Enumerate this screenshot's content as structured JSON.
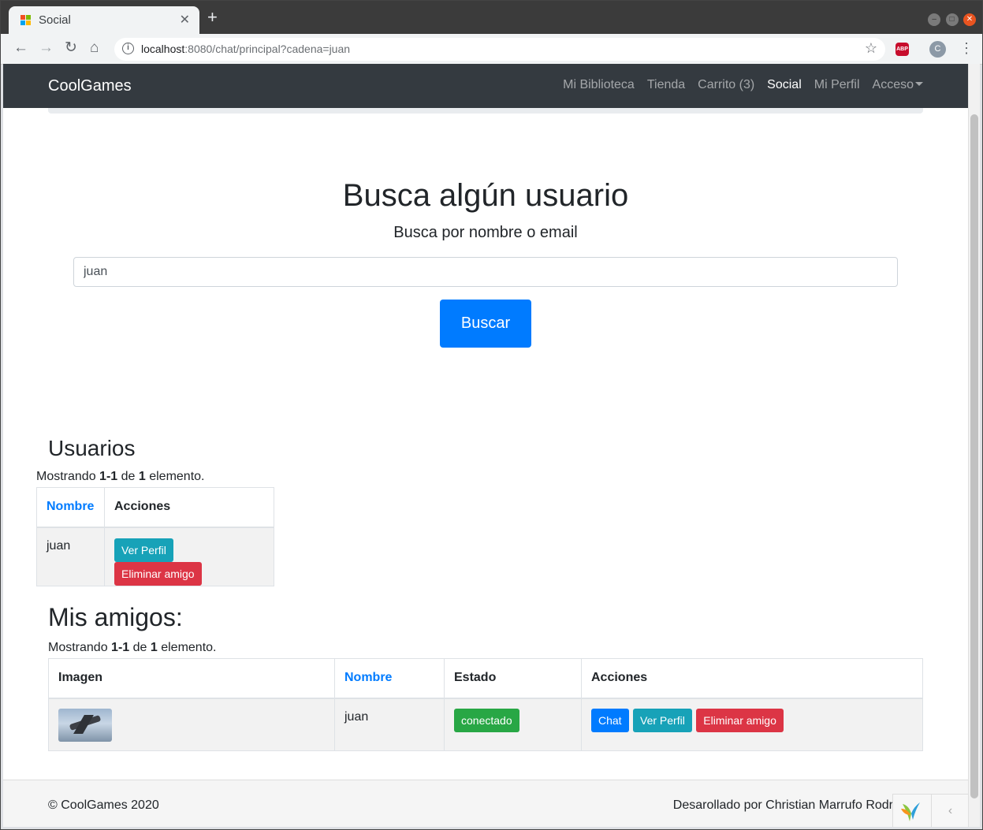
{
  "browser": {
    "tab_title": "Social",
    "tab_close": "✕",
    "new_tab": "+",
    "url_host": "localhost",
    "url_rest": ":8080/chat/principal?cadena=juan",
    "abp_label": "ABP",
    "profile_initial": "C"
  },
  "navbar": {
    "brand": "CoolGames",
    "links": [
      "Mi Biblioteca",
      "Tienda",
      "Carrito (3)",
      "Social",
      "Mi Perfil",
      "Acceso"
    ],
    "active": "Social"
  },
  "search": {
    "title": "Busca algún usuario",
    "subtitle": "Busca por nombre o email",
    "value": "juan",
    "button": "Buscar"
  },
  "usuarios": {
    "title": "Usuarios",
    "summary_prefix": "Mostrando ",
    "summary_range": "1-1",
    "summary_mid": " de ",
    "summary_total": "1",
    "summary_suffix": " elemento.",
    "headers": [
      "Nombre",
      "Acciones"
    ],
    "rows": [
      {
        "nombre": "juan",
        "ver_perfil": "Ver Perfil",
        "eliminar": "Eliminar amigo"
      }
    ]
  },
  "amigos": {
    "title": "Mis amigos:",
    "summary_prefix": "Mostrando ",
    "summary_range": "1-1",
    "summary_mid": " de ",
    "summary_total": "1",
    "summary_suffix": " elemento.",
    "headers": [
      "Imagen",
      "Nombre",
      "Estado",
      "Acciones"
    ],
    "rows": [
      {
        "nombre": "juan",
        "estado": "conectado",
        "chat": "Chat",
        "ver_perfil": "Ver Perfil",
        "eliminar": "Eliminar amigo"
      }
    ]
  },
  "footer": {
    "copyright": "© CoolGames 2020",
    "credit": "Desarollado por Christian Marrufo Rodr",
    "debug_toggle": "‹"
  },
  "colors": {
    "primary": "#007bff",
    "info": "#17a2b8",
    "danger": "#dc3545",
    "success": "#28a745",
    "navbar": "#343a40"
  }
}
